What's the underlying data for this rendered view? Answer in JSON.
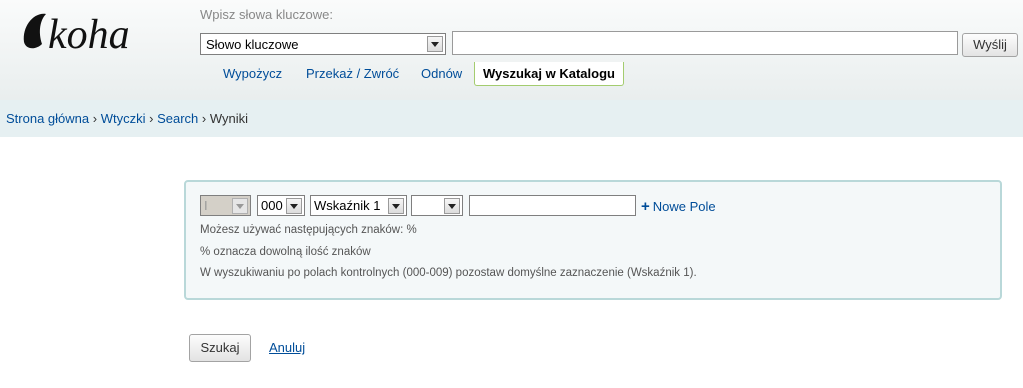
{
  "logo": {
    "text": "koha"
  },
  "search": {
    "label": "Wpisz słowa kluczowe:",
    "select_value": "Słowo kluczowe",
    "input_value": "",
    "submit_label": "Wyślij"
  },
  "tabs": [
    "Wypożycz",
    "Przekaż / Zwróć",
    "Odnów",
    "Wyszukaj w Katalogu"
  ],
  "breadcrumb": {
    "items": [
      "Strona główna",
      "Wtyczki",
      "Search"
    ],
    "separator": "›",
    "current": "Wyniki"
  },
  "form": {
    "op_select": "I",
    "field_select": "000",
    "indicator_select": "Wskaźnik 1",
    "subfield_select": "",
    "value": "",
    "new_field_label": "Nowe Pole",
    "hints": [
      "Możesz używać następujących znaków: %",
      "% oznacza dowolną ilość znaków",
      "W wyszukiwaniu po polach kontrolnych (000-009) pozostaw domyślne zaznaczenie (Wskaźnik 1)."
    ],
    "search_button": "Szukaj",
    "cancel_link": "Anuluj"
  }
}
